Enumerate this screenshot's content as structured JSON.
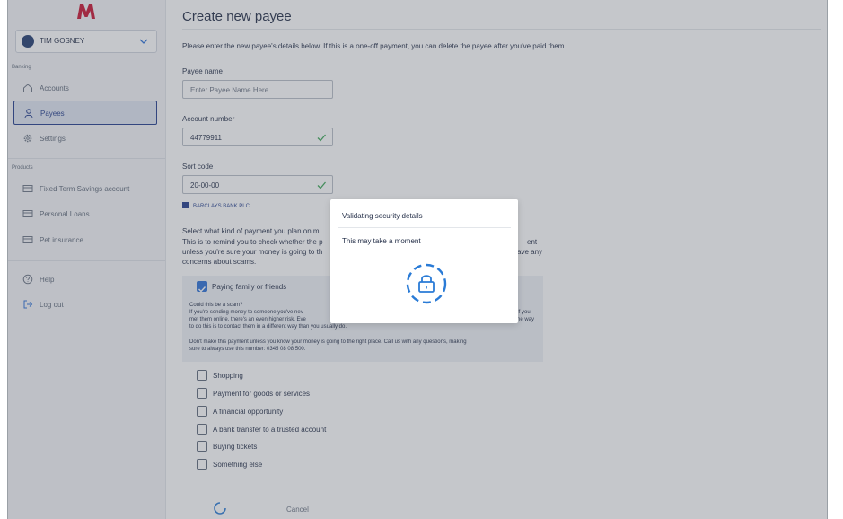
{
  "sidebar": {
    "user_name": "TIM GOSNEY",
    "section_banking": "Banking",
    "section_products": "Products",
    "items": [
      {
        "label": "Accounts",
        "icon": "home-icon"
      },
      {
        "label": "Payees",
        "icon": "person-icon",
        "active": true
      },
      {
        "label": "Settings",
        "icon": "gear-icon"
      },
      {
        "label": "Fixed Term Savings account",
        "icon": "card-icon"
      },
      {
        "label": "Personal Loans",
        "icon": "card-icon"
      },
      {
        "label": "Pet insurance",
        "icon": "card-icon"
      },
      {
        "label": "Help",
        "icon": "help-icon"
      },
      {
        "label": "Log out",
        "icon": "logout-icon"
      }
    ]
  },
  "colors": {
    "brand": "#c8102e",
    "accent": "#1f3a8a",
    "check_green": "#3aa655",
    "spinner": "#2a7bd6"
  },
  "main": {
    "title": "Create new payee",
    "intro": "Please enter the new payee's details below. If this is a one-off payment, you can delete the payee after you've paid them.",
    "payee_name_label": "Payee name",
    "payee_name_placeholder": "Enter Payee Name Here",
    "account_number_label": "Account number",
    "account_number_value": "44779911",
    "sort_code_label": "Sort code",
    "sort_code_value": "20-00-00",
    "bank_name": "BARCLAYS BANK PLC",
    "payment_kind_heading": "Select what kind of payment you plan on m",
    "payment_kind_line1": "This is to remind you to check whether the p",
    "payment_kind_line1_end": "ent",
    "payment_kind_line2": "unless you're sure your money is going to th",
    "payment_kind_line2_end": "ave any",
    "payment_kind_line3": "concerns about scams.",
    "options": [
      {
        "label": "Paying family or friends",
        "checked": true
      },
      {
        "label": "Shopping",
        "checked": false
      },
      {
        "label": "Payment for goods or services",
        "checked": false
      },
      {
        "label": "A financial opportunity",
        "checked": false
      },
      {
        "label": "A bank transfer to a trusted account",
        "checked": false
      },
      {
        "label": "Buying tickets",
        "checked": false
      },
      {
        "label": "Something else",
        "checked": false
      }
    ],
    "scam_title": "Could this be a scam?",
    "scam_line1": "If you're sending money to someone you've nev",
    "scam_line1_end": "If you",
    "scam_line2": "met them online, there's an even higher risk. Eve",
    "scam_line2_end": "ne way",
    "scam_line3": "to do this is to contact them in a different way than you usually do.",
    "scam_line4": "Don't make this payment unless you know your money is going to the right place. Call us with any questions, making",
    "scam_line5": "sure to always use this number: 0345 08 08 500.",
    "cancel_label": "Cancel"
  },
  "modal": {
    "title": "Validating security details",
    "message": "This may take a moment",
    "icon": "lock-icon"
  }
}
